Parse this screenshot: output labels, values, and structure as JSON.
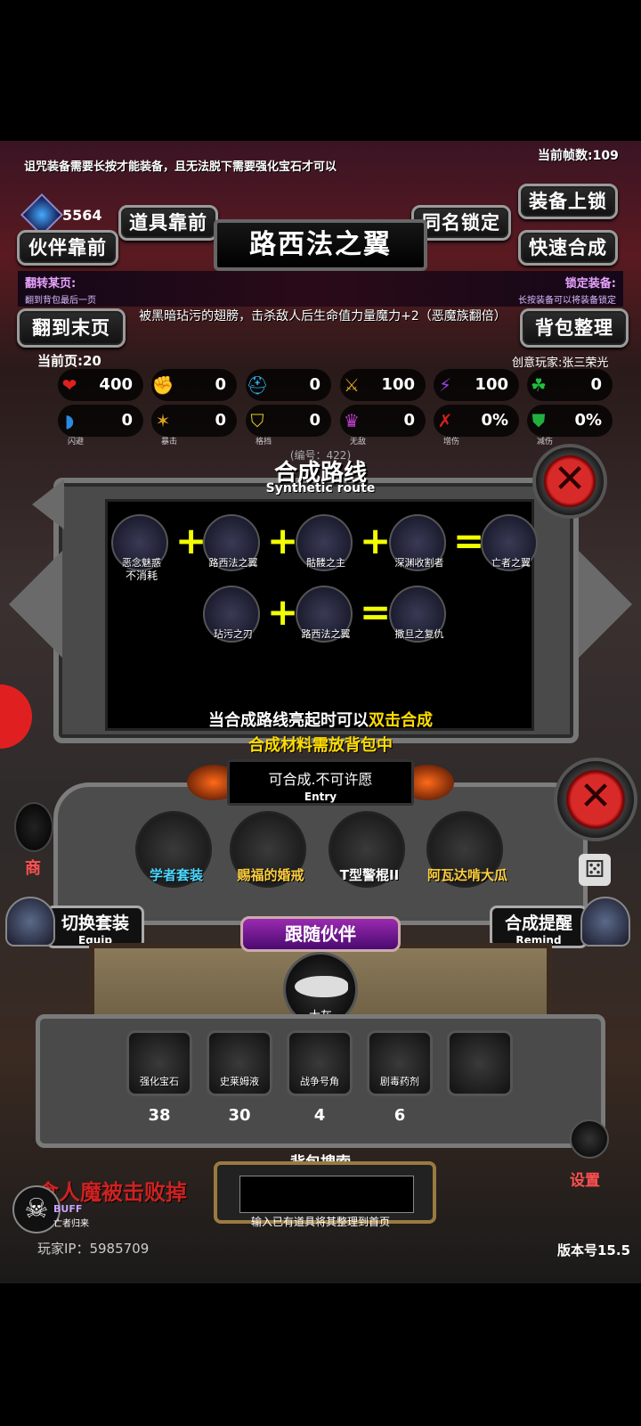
{
  "top_hint": "诅咒装备需要长按才能装备，且无法脱下需要强化宝石才可以",
  "fps_label": "当前帧数:109",
  "gems": "5564",
  "buttons": {
    "item_front": "道具靠前",
    "partner_front": "伙伴靠前",
    "same_name_lock": "同名锁定",
    "equip_lock": "装备上锁",
    "quick_craft": "快速合成",
    "go_last_page": "翻到末页",
    "sort_bag": "背包整理"
  },
  "item_title": "路西法之翼",
  "info": {
    "flip_title": "翻转某页:",
    "flip_sub": "翻到背包最后一页",
    "lock_title": "锁定装备:",
    "lock_sub": "长按装备可以将装备锁定"
  },
  "description": "被黑暗玷污的翅膀，击杀敌人后生命值力量魔力+2（恶魔族翻倍）",
  "current_page": "当前页:20",
  "creator": "创意玩家:张三荣光",
  "stats_row1": [
    {
      "icon": "heart-icon",
      "symbol": "❤",
      "color": "#e02020",
      "value": "400"
    },
    {
      "icon": "strength-icon",
      "symbol": "✊",
      "color": "#e0b020",
      "value": "0"
    },
    {
      "icon": "helmet-icon",
      "symbol": "⛑",
      "color": "#2aa8e0",
      "value": "0"
    },
    {
      "icon": "sword-icon",
      "symbol": "⚔",
      "color": "#d8a020",
      "value": "100"
    },
    {
      "icon": "magic-icon",
      "symbol": "⚡",
      "color": "#9a40e0",
      "value": "100"
    },
    {
      "icon": "clover-icon",
      "symbol": "☘",
      "color": "#20c040",
      "value": "0"
    }
  ],
  "stats_row2": [
    {
      "icon": "dodge-icon",
      "symbol": "◗",
      "color": "#2a8ae0",
      "value": "0",
      "label": "闪避"
    },
    {
      "icon": "crit-icon",
      "symbol": "✶",
      "color": "#e0a020",
      "value": "0",
      "label": "暴击"
    },
    {
      "icon": "block-icon",
      "symbol": "⛉",
      "color": "#e0d020",
      "value": "0",
      "label": "格挡"
    },
    {
      "icon": "invincible-icon",
      "symbol": "♛",
      "color": "#c040d0",
      "value": "0",
      "label": "无敌"
    },
    {
      "icon": "damage-up-icon",
      "symbol": "✗",
      "color": "#d02020",
      "value": "0%",
      "label": "增伤"
    },
    {
      "icon": "damage-reduce-icon",
      "symbol": "⛊",
      "color": "#20b040",
      "value": "0%",
      "label": "减伤"
    }
  ],
  "route": {
    "number_label": "(编号：422)",
    "title": "合成路线",
    "subtitle": "Synthetic route",
    "row1": [
      {
        "name": "恶念魅惑",
        "sub": "不消耗"
      },
      {
        "name": "路西法之翼"
      },
      {
        "name": "骷髅之主"
      },
      {
        "name": "深渊收割者"
      },
      {
        "name": "亡者之翼"
      }
    ],
    "row2": [
      {
        "name": "玷污之刃"
      },
      {
        "name": "路西法之翼"
      },
      {
        "name": "撒旦之复仇"
      }
    ]
  },
  "tips": {
    "line1_a": "当合成路线亮起时可以",
    "line1_b": "双击合成",
    "line2": "合成材料需放背包中"
  },
  "entry": {
    "text": "可合成.不可许愿",
    "label": "Entry"
  },
  "equipment": [
    {
      "name": "学者套装",
      "color": "#4cd8ff"
    },
    {
      "name": "赐福的婚戒",
      "color": "#ffd040"
    },
    {
      "name": "T型警棍II",
      "color": "#ffffff"
    },
    {
      "name": "阿瓦达啃大瓜",
      "color": "#ffd040"
    }
  ],
  "switch_set": {
    "label": "切换套装",
    "sub": "Equip"
  },
  "craft_remind": {
    "label": "合成提醒",
    "sub": "Remind"
  },
  "follow": {
    "title": "跟随伙伴",
    "partner": "大灰"
  },
  "inventory": [
    {
      "name": "强化宝石",
      "count": "38"
    },
    {
      "name": "史莱姆液",
      "count": "30"
    },
    {
      "name": "战争号角",
      "count": "4"
    },
    {
      "name": "剧毒药剂",
      "count": "6"
    }
  ],
  "side": {
    "shop": "商",
    "settings": "设置"
  },
  "search": {
    "title": "背包搜索",
    "hint": "输入已有道具将其整理到首页",
    "value": ""
  },
  "news": "食人魔被击败掉",
  "buff": {
    "label": "BUFF",
    "sub": "亡者归来"
  },
  "player_ip": "玩家IP：5985709",
  "version": "版本号15.5"
}
